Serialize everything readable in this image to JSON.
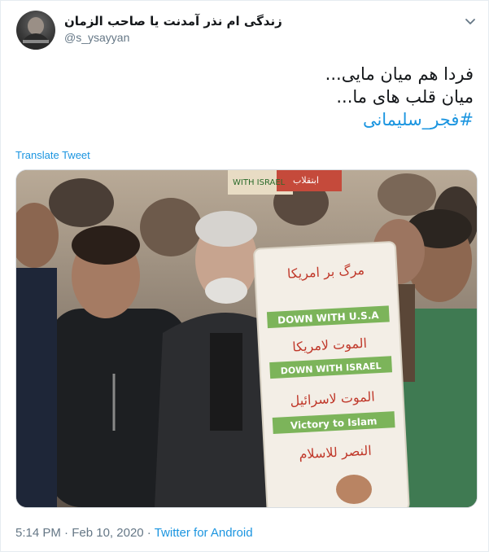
{
  "tweet": {
    "display_name": "زندگی ام نذر آمدنت یا صاحب الزمان",
    "handle": "@s_ysayyan",
    "lines": [
      "فردا هم میان مایی...",
      "میان قلب های ما..."
    ],
    "hashtag": "#فجر_سلیمانی",
    "translate_label": "Translate Tweet",
    "time": "5:14 PM",
    "separator": " · ",
    "date": "Feb 10, 2020",
    "source": "Twitter for Android"
  },
  "photo": {
    "sign_lines": [
      "مرگ بر امریکا",
      "DOWN WITH U.S.A",
      "الموت لامریکا",
      "DOWN WITH ISRAEL",
      "الموت لاسرائیل",
      "Victory to Islam",
      "النصر للاسلام"
    ],
    "banner_text": "WITH ISRAEL",
    "banner_text_2": "ابتقلاب"
  },
  "colors": {
    "link": "#1b95e0",
    "muted": "#657786",
    "text": "#14171a",
    "sign_green": "#6fae4b",
    "sign_red": "#c0392b"
  },
  "icons": {
    "more": "chevron-down-icon"
  }
}
